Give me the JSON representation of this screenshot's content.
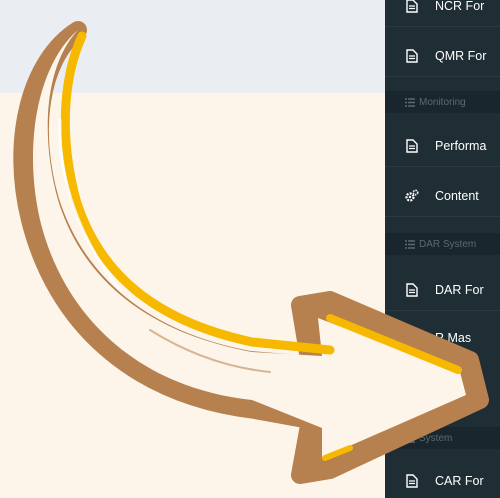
{
  "sidebar": {
    "items": [
      {
        "type": "item",
        "icon": "document-icon",
        "label": "NCR For"
      },
      {
        "type": "item",
        "icon": "document-icon",
        "label": "QMR For"
      },
      {
        "type": "header",
        "icon": "list-icon",
        "label": "Monitoring"
      },
      {
        "type": "item",
        "icon": "document-icon",
        "label": "Performa"
      },
      {
        "type": "item",
        "icon": "gears-icon",
        "label": "Content"
      },
      {
        "type": "header",
        "icon": "list-icon",
        "label": "DAR System"
      },
      {
        "type": "item",
        "icon": "document-icon",
        "label": "DAR For"
      },
      {
        "type": "item",
        "icon": "document-icon",
        "label": "R Mas"
      },
      {
        "type": "header",
        "icon": "list-icon",
        "label": "System"
      },
      {
        "type": "item",
        "icon": "document-icon",
        "label": "CAR For"
      }
    ]
  },
  "arrow": {
    "icon": "curved-arrow-icon",
    "colors": {
      "outline": "#b6804f",
      "fill": "#fdf5e9",
      "highlight": "#f7b800"
    }
  }
}
